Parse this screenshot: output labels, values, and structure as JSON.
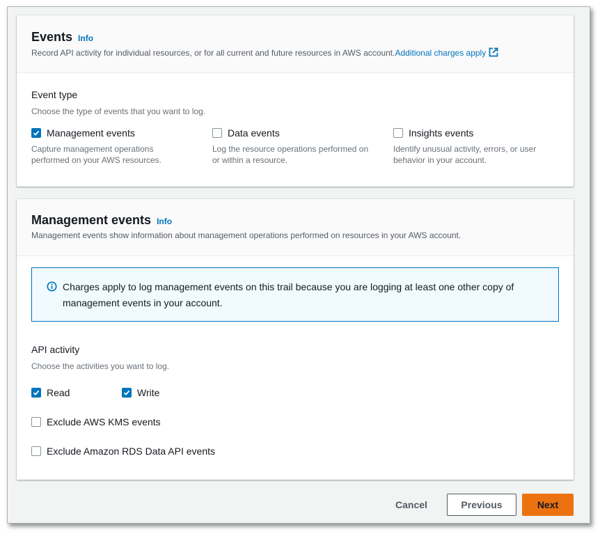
{
  "events_panel": {
    "title": "Events",
    "info_label": "Info",
    "description": "Record API activity for individual resources, or for all current and future resources in AWS account.",
    "charges_link": "Additional charges apply",
    "event_type": {
      "label": "Event type",
      "description": "Choose the type of events that you want to log.",
      "options": [
        {
          "label": "Management events",
          "checked": true,
          "description_line1": "Capture management operations",
          "description_line2": "performed on your AWS resources."
        },
        {
          "label": "Data events",
          "checked": false,
          "description_line1": "Log the resource operations performed on",
          "description_line2": "or within a resource."
        },
        {
          "label": "Insights events",
          "checked": false,
          "description_line1": "Identify unusual activity, errors, or user",
          "description_line2": "behavior in your account."
        }
      ]
    }
  },
  "management_panel": {
    "title": "Management events",
    "info_label": "Info",
    "description": "Management events show information about management operations performed on resources in your AWS account.",
    "alert": {
      "icon": "info-circle-icon",
      "line1": "Charges apply to log management events on this trail because you are logging at least one other copy of",
      "line2": "management events in your account."
    },
    "api_activity": {
      "label": "API activity",
      "description": "Choose the activities you want to log.",
      "read": {
        "label": "Read",
        "checked": true
      },
      "write": {
        "label": "Write",
        "checked": true
      },
      "exclude_kms": {
        "label": "Exclude AWS KMS events",
        "checked": false
      },
      "exclude_rds": {
        "label": "Exclude Amazon RDS Data API events",
        "checked": false
      }
    }
  },
  "footer": {
    "cancel_label": "Cancel",
    "previous_label": "Previous",
    "next_label": "Next"
  },
  "colors": {
    "link": "#0073bb",
    "primary_button": "#ec7211",
    "checkbox_checked": "#0073bb",
    "alert_background": "#f1faff"
  }
}
